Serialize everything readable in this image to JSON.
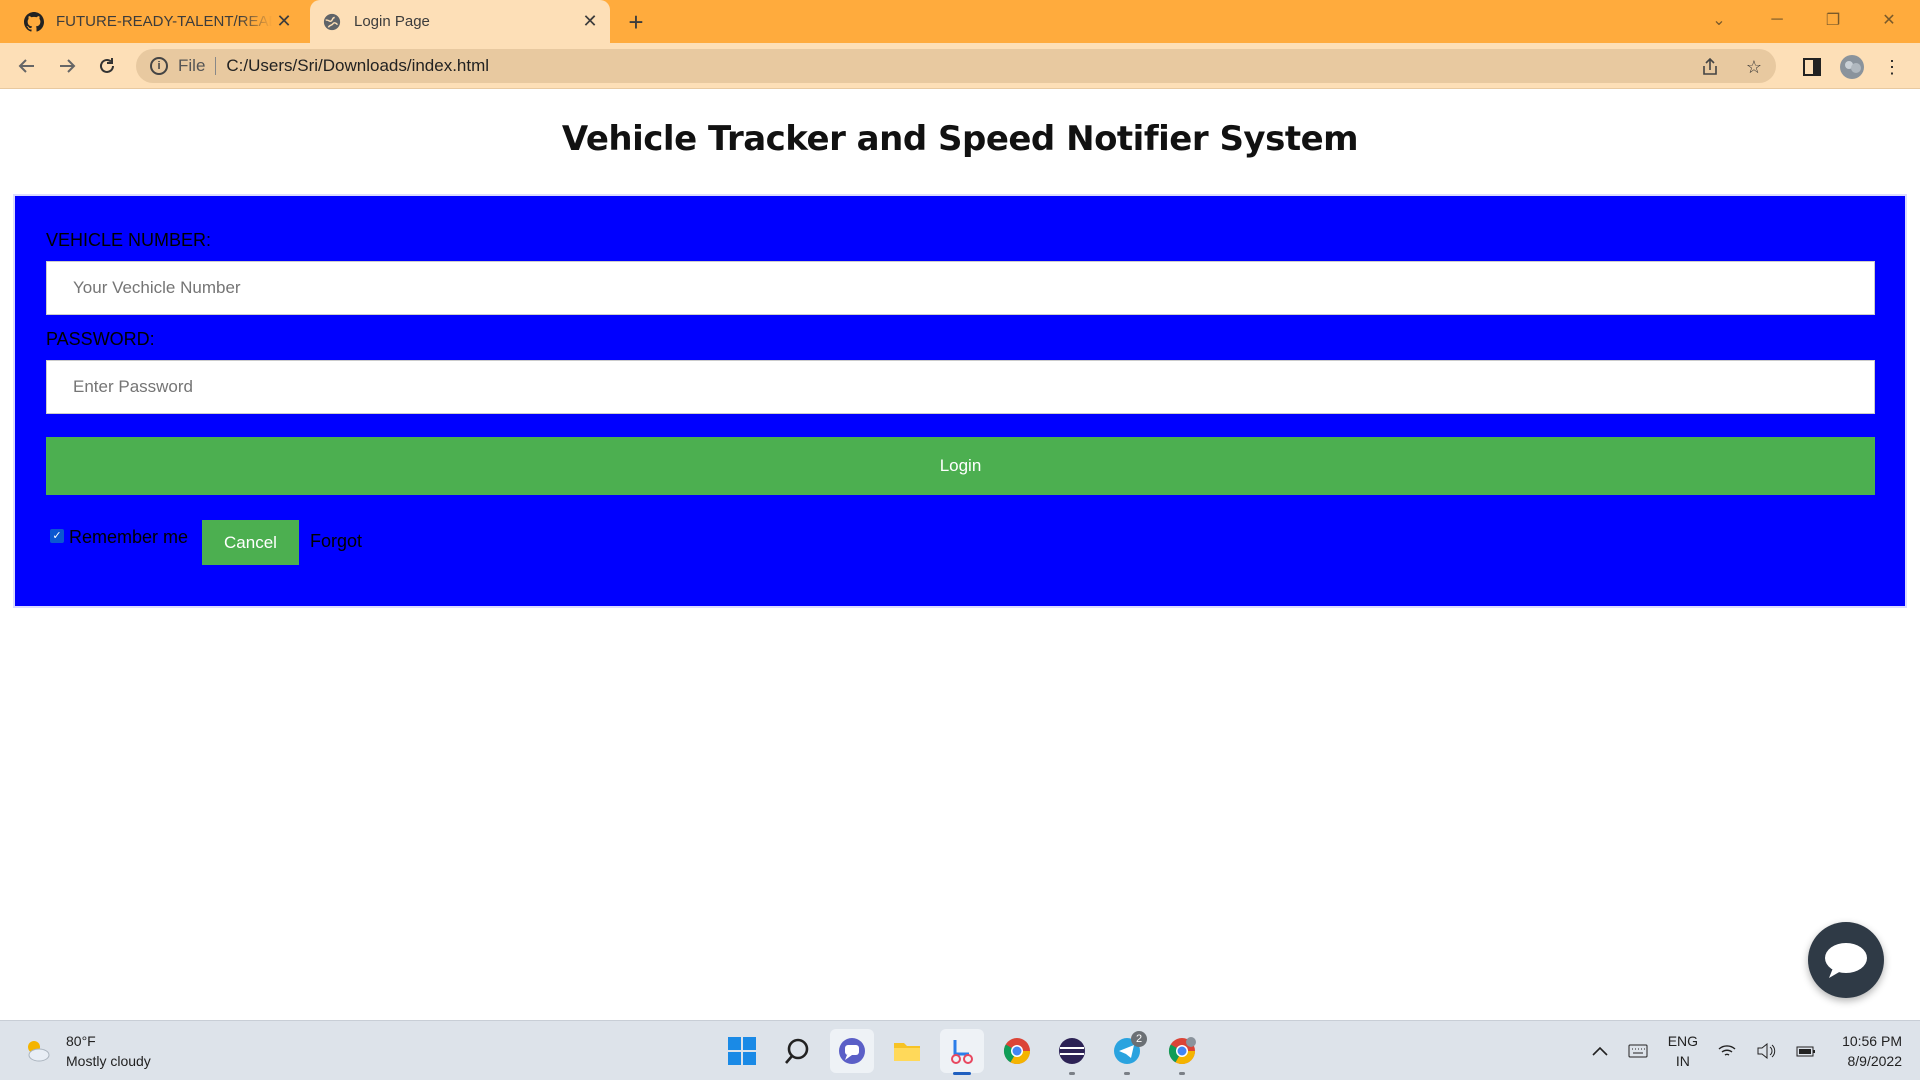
{
  "browser": {
    "tabs": [
      {
        "label": "FUTURE-READY-TALENT/README",
        "icon": "github-icon",
        "active": false
      },
      {
        "label": "Login Page",
        "icon": "globe-icon",
        "active": true
      }
    ],
    "url_scheme": "File",
    "url": "C:/Users/Sri/Downloads/index.html"
  },
  "page": {
    "title": "Vehicle Tracker and Speed Notifier System",
    "form": {
      "vehicle_label": "VEHICLE NUMBER:",
      "vehicle_placeholder": "Your Vechicle Number",
      "password_label": "PASSWORD:",
      "password_placeholder": "Enter Password",
      "login_label": "Login",
      "remember_label": "Remember me",
      "remember_checked": true,
      "cancel_label": "Cancel",
      "forgot_label": "Forgot"
    },
    "colors": {
      "form_bg": "#0000ff",
      "button_bg": "#4caf50",
      "tab_strip": "#ffab3d"
    }
  },
  "taskbar": {
    "weather_temp": "80°F",
    "weather_desc": "Mostly cloudy",
    "telegram_badge": "2",
    "lang_top": "ENG",
    "lang_bottom": "IN",
    "time": "10:56 PM",
    "date": "8/9/2022"
  }
}
